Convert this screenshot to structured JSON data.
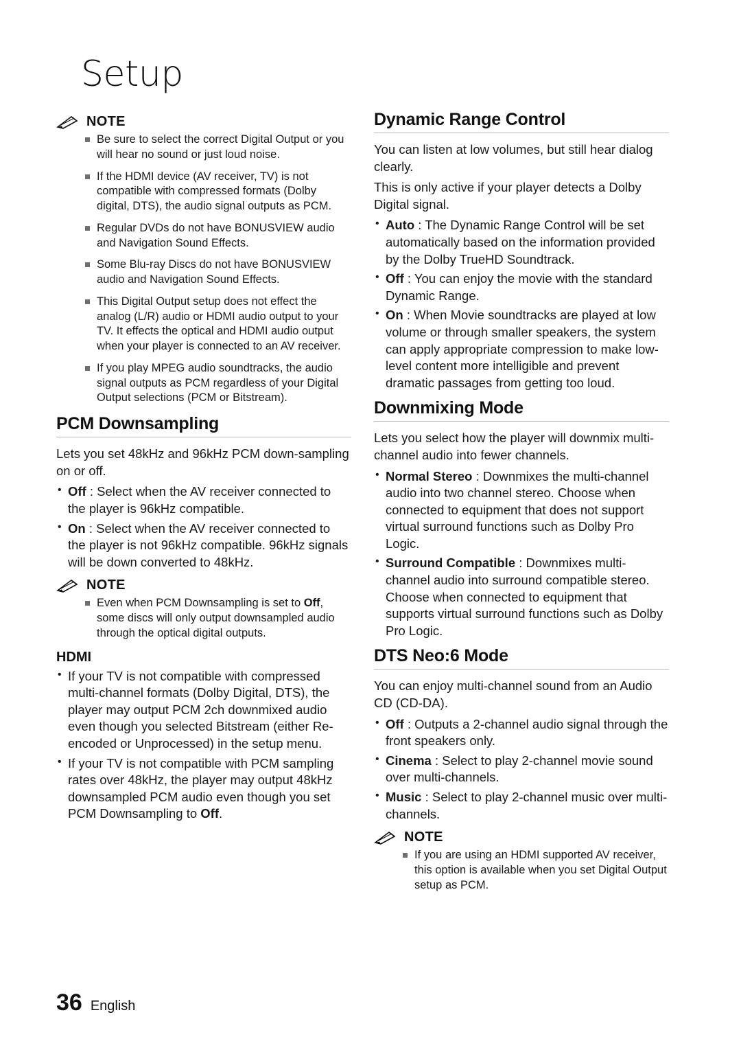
{
  "chapter": {
    "title": "Setup"
  },
  "footer": {
    "page_number": "36",
    "language": "English"
  },
  "left_column": {
    "note1": {
      "label": "NOTE",
      "items": [
        "Be sure to select the correct Digital Output or you will hear no sound or just loud noise.",
        "If the HDMI device (AV receiver, TV) is not compatible with compressed formats (Dolby digital, DTS), the audio signal outputs as PCM.",
        "Regular DVDs do not have BONUSVIEW audio and Navigation Sound Effects.",
        "Some Blu-ray Discs do not have BONUSVIEW audio and Navigation Sound Effects.",
        "This Digital Output setup does not effect the analog (L/R) audio or HDMI audio output to your TV. It effects the optical and HDMI audio output when your player is connected to an AV receiver.",
        "If you play MPEG audio soundtracks, the audio signal outputs as PCM regardless of your Digital Output selections (PCM or Bitstream)."
      ]
    },
    "pcm_downsampling": {
      "heading": "PCM Downsampling",
      "intro": "Lets you set 48kHz and 96kHz PCM down-sampling on or off.",
      "options": [
        {
          "term": "Off",
          "sep": " : ",
          "text": "Select when the AV receiver connected to the player is 96kHz compatible."
        },
        {
          "term": "On",
          "sep": " : ",
          "text": "Select when the AV receiver connected to the player is not 96kHz compatible. 96kHz signals will be down converted to 48kHz."
        }
      ]
    },
    "note2": {
      "label": "NOTE",
      "item_pre": "Even when PCM Downsampling is set to ",
      "item_bold": "Off",
      "item_post": ", some discs will only output downsampled audio through the optical digital outputs."
    },
    "hdmi": {
      "heading": "HDMI",
      "bullets": [
        "If your TV is not compatible with compressed multi-channel formats (Dolby Digital, DTS), the player may output PCM 2ch downmixed audio even though you selected Bitstream (either Re-encoded or Unprocessed) in the setup menu.",
        "If your TV is not compatible with PCM sampling rates over 48kHz, the player may output 48kHz downsampled PCM audio even though you set PCM Downsampling to "
      ],
      "bullet2_bold": "Off",
      "bullet2_end": "."
    }
  },
  "right_column": {
    "dynamic_range": {
      "heading": "Dynamic Range Control",
      "intro1": "You can listen at low volumes, but still hear dialog clearly.",
      "intro2": "This is only active if your player detects a Dolby Digital signal.",
      "options": [
        {
          "term": "Auto",
          "sep": " : ",
          "text": "The Dynamic Range Control will be set automatically based on the information provided by the Dolby TrueHD Soundtrack."
        },
        {
          "term": "Off",
          "sep": " : ",
          "text": "You can enjoy the movie with the standard Dynamic Range."
        },
        {
          "term": "On",
          "sep": " : ",
          "text": "When Movie soundtracks are played at low volume or through smaller speakers, the system can apply appropriate compression to make low-level content more intelligible and prevent dramatic passages from getting too loud."
        }
      ]
    },
    "downmixing": {
      "heading": "Downmixing Mode",
      "intro": "Lets you select how the player will downmix multi-channel audio into fewer channels.",
      "options": [
        {
          "term": "Normal Stereo",
          "sep": " : ",
          "text": "Downmixes the multi-channel audio into two channel stereo. Choose when connected to equipment that does not support virtual surround functions such as Dolby Pro Logic."
        },
        {
          "term": "Surround Compatible",
          "sep": " : ",
          "text": "Downmixes multi-channel audio into surround compatible stereo. Choose when connected to equipment that supports virtual surround functions such as Dolby Pro Logic."
        }
      ]
    },
    "dts_neo6": {
      "heading": "DTS Neo:6 Mode",
      "intro": "You can enjoy multi-channel sound from an Audio CD (CD-DA).",
      "options": [
        {
          "term": "Off",
          "sep": " : ",
          "text": "Outputs a 2-channel audio signal through the front speakers only."
        },
        {
          "term": "Cinema",
          "sep": " : ",
          "text": "Select to play 2-channel movie sound over multi-channels."
        },
        {
          "term": "Music",
          "sep": " : ",
          "text": "Select to play 2-channel music over multi-channels."
        }
      ]
    },
    "note3": {
      "label": "NOTE",
      "items": [
        "If you are using an HDMI supported AV receiver, this option is available when you set Digital Output setup as PCM."
      ]
    }
  }
}
